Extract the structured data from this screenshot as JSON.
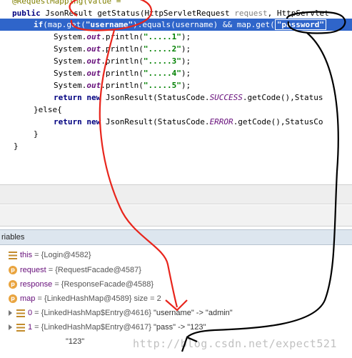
{
  "editor": {
    "lines": [
      {
        "text": "@RequestMapping(value = \"\""
      },
      {
        "kw": "public",
        "text_a": " JsonResult getStatus(HttpServletRequest ",
        "param": "request",
        "text_b": ", HttpServlet"
      },
      {
        "kw": "if",
        "text_a": "(map.get(",
        "str_a": "\"username\"",
        "text_b": ").equals(username) && map.get(",
        "str_b": "\"password\""
      },
      {
        "obj": "System.",
        "fld": "out",
        "call": ".println(",
        "str": "\".....1\"",
        "end": ");"
      },
      {
        "obj": "System.",
        "fld": "out",
        "call": ".println(",
        "str": "\".....2\"",
        "end": ");"
      },
      {
        "obj": "System.",
        "fld": "out",
        "call": ".println(",
        "str": "\".....3\"",
        "end": ");"
      },
      {
        "obj": "System.",
        "fld": "out",
        "call": ".println(",
        "str": "\".....4\"",
        "end": ");"
      },
      {
        "obj": "System.",
        "fld": "out",
        "call": ".println(",
        "str": "\".....5\"",
        "end": ");"
      },
      {
        "kw": "return new",
        "text_a": " JsonResult(StatusCode.",
        "sta": "SUCCESS",
        "text_b": ".getCode(),Status"
      },
      {
        "text": "}else{"
      },
      {
        "kw": "return new",
        "text_a": " JsonResult(StatusCode.",
        "sta": "ERROR",
        "text_b": ".getCode(),StatusCo"
      },
      {
        "text": "}"
      },
      {
        "text": "}"
      }
    ]
  },
  "variables": {
    "header": "riables",
    "rows": [
      {
        "name": "this",
        "value": " = {Login@4582}"
      },
      {
        "name": "request",
        "value": " = {RequestFacade@4587}"
      },
      {
        "name": "response",
        "value": " = {ResponseFacade@4588}"
      },
      {
        "name": "map",
        "value": " = {LinkedHashMap@4589}  size = 2"
      },
      {
        "name": "0",
        "value": " = {LinkedHashMap$Entry@4616} ",
        "extra": "\"username\" -> \"admin\""
      },
      {
        "name": "1",
        "value": " = {LinkedHashMap$Entry@4617} ",
        "extra": "\"pass\" -> \"123\""
      },
      {
        "name": "",
        "value": "\"123\""
      }
    ]
  },
  "watermark": "http://blog.csdn.net/expect521",
  "colors": {
    "selection": "#2f65ca",
    "ink_red": "#e8251c",
    "ink_black": "#000000"
  }
}
